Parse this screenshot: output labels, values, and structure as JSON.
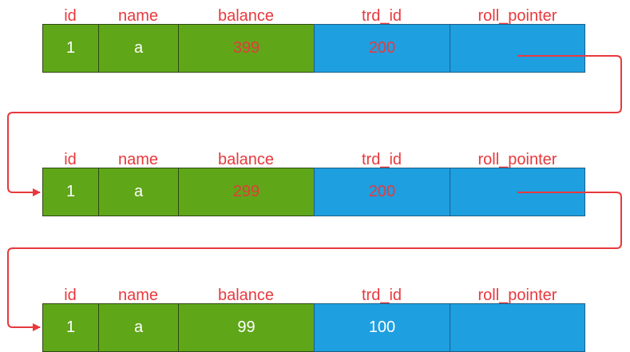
{
  "headers": [
    "id",
    "name",
    "balance",
    "trd_id",
    "roll_pointer"
  ],
  "rows": [
    {
      "id": "1",
      "name": "a",
      "balance": "399",
      "trd_id": "200",
      "roll_pointer": ""
    },
    {
      "id": "1",
      "name": "a",
      "balance": "299",
      "trd_id": "200",
      "roll_pointer": ""
    },
    {
      "id": "1",
      "name": "a",
      "balance": "99",
      "trd_id": "100",
      "roll_pointer": ""
    }
  ],
  "colors": {
    "green": "#5fa619",
    "blue": "#1e9fe0",
    "red": "#e8393d",
    "white": "#ffffff"
  }
}
